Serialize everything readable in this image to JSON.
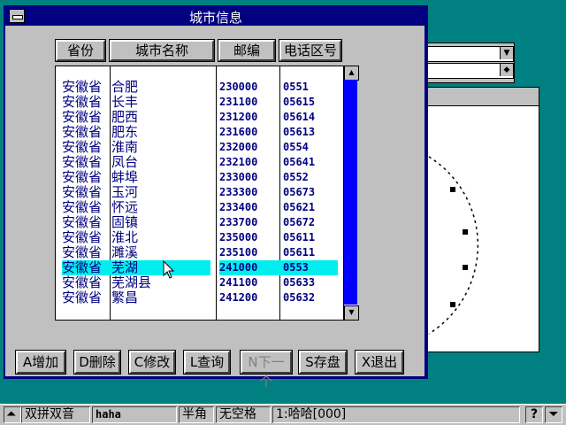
{
  "window": {
    "title": "城市信息"
  },
  "columns": [
    "省份",
    "城市名称",
    "邮编",
    "电话区号"
  ],
  "rows": [
    [
      "安徽省",
      "合肥",
      "230000",
      "0551"
    ],
    [
      "安徽省",
      "长丰",
      "231100",
      "05615"
    ],
    [
      "安徽省",
      "肥西",
      "231200",
      "05614"
    ],
    [
      "安徽省",
      "肥东",
      "231600",
      "05613"
    ],
    [
      "安徽省",
      "淮南",
      "232000",
      "0554"
    ],
    [
      "安徽省",
      "凤台",
      "232100",
      "05641"
    ],
    [
      "安徽省",
      "蚌埠",
      "233000",
      "0552"
    ],
    [
      "安徽省",
      "玉河",
      "233300",
      "05673"
    ],
    [
      "安徽省",
      "怀远",
      "233400",
      "05621"
    ],
    [
      "安徽省",
      "固镇",
      "233700",
      "05672"
    ],
    [
      "安徽省",
      "淮北",
      "235000",
      "05611"
    ],
    [
      "安徽省",
      "濉溪",
      "235100",
      "05611"
    ],
    [
      "安徽省",
      "芜湖",
      "241000",
      "0553"
    ],
    [
      "安徽省",
      "芜湖县",
      "241100",
      "05633"
    ],
    [
      "安徽省",
      "繁昌",
      "241200",
      "05632"
    ]
  ],
  "selected_row": 12,
  "buttons": {
    "add": "A增加",
    "delete": "D删除",
    "modify": "C修改",
    "query": "L查询",
    "disabled": "N下一个",
    "save": "S存盘",
    "exit": "X退出"
  },
  "taskbar": {
    "ime": "双拼双音",
    "user": "haha",
    "width": "半角",
    "space": "无空格",
    "candidate": "1:哈哈[000]",
    "help": "?"
  },
  "colors": {
    "selection": "#00eeee",
    "title_bg": "#000080",
    "thumb": "#0000ff"
  }
}
